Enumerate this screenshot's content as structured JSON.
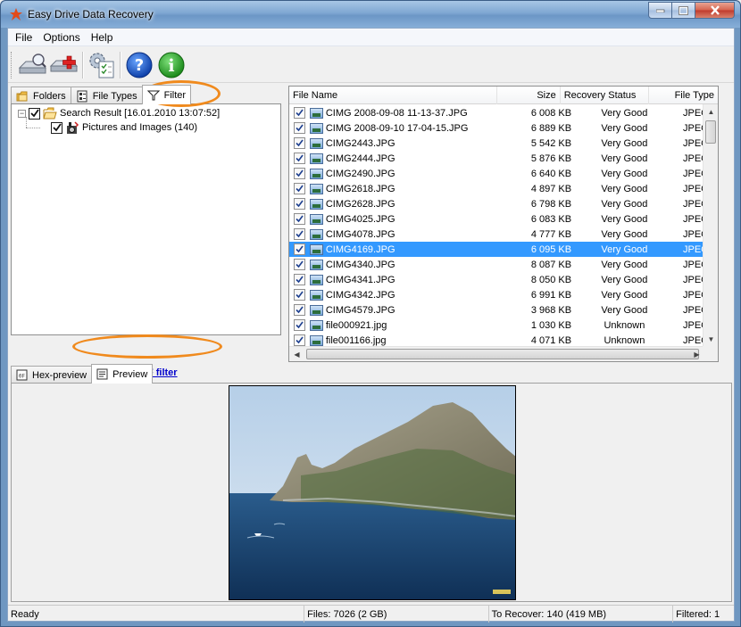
{
  "window": {
    "title": "Easy Drive Data Recovery",
    "buttons": {
      "minimize": "–",
      "maximize": "□",
      "close": "✕"
    }
  },
  "menu": [
    "File",
    "Options",
    "Help"
  ],
  "toolbar": {
    "icons": [
      "scan-drive-icon",
      "drive-recover-icon",
      "settings-icon",
      "help-icon",
      "info-icon"
    ]
  },
  "left_tabs": [
    {
      "label": "Folders",
      "icon": "folders-icon"
    },
    {
      "label": "File Types",
      "icon": "file-types-icon"
    },
    {
      "label": "Filter",
      "icon": "filter-icon",
      "active": true
    }
  ],
  "tree": {
    "root": {
      "label": "Search Result [16.01.2010 13:07:52]",
      "checked": true,
      "expanded": true
    },
    "child": {
      "label": "Pictures and Images (140)",
      "checked": true
    }
  },
  "filter_link": "Turn OFF filter",
  "file_list": {
    "columns": [
      "File Name",
      "Size",
      "Recovery Status",
      "File Type"
    ],
    "rows": [
      {
        "name": "CIMG 2008-09-08 11-13-37.JPG",
        "size": "6 008 KB",
        "status": "Very Good",
        "type": "JPEG"
      },
      {
        "name": "CIMG 2008-09-10 17-04-15.JPG",
        "size": "6 889 KB",
        "status": "Very Good",
        "type": "JPEG"
      },
      {
        "name": "CIMG2443.JPG",
        "size": "5 542 KB",
        "status": "Very Good",
        "type": "JPEG"
      },
      {
        "name": "CIMG2444.JPG",
        "size": "5 876 KB",
        "status": "Very Good",
        "type": "JPEG"
      },
      {
        "name": "CIMG2490.JPG",
        "size": "6 640 KB",
        "status": "Very Good",
        "type": "JPEG"
      },
      {
        "name": "CIMG2618.JPG",
        "size": "4 897 KB",
        "status": "Very Good",
        "type": "JPEG"
      },
      {
        "name": "CIMG2628.JPG",
        "size": "6 798 KB",
        "status": "Very Good",
        "type": "JPEG"
      },
      {
        "name": "CIMG4025.JPG",
        "size": "6 083 KB",
        "status": "Very Good",
        "type": "JPEG"
      },
      {
        "name": "CIMG4078.JPG",
        "size": "4 777 KB",
        "status": "Very Good",
        "type": "JPEG"
      },
      {
        "name": "CIMG4169.JPG",
        "size": "6 095 KB",
        "status": "Very Good",
        "type": "JPEG",
        "selected": true
      },
      {
        "name": "CIMG4340.JPG",
        "size": "8 087 KB",
        "status": "Very Good",
        "type": "JPEG"
      },
      {
        "name": "CIMG4341.JPG",
        "size": "8 050 KB",
        "status": "Very Good",
        "type": "JPEG"
      },
      {
        "name": "CIMG4342.JPG",
        "size": "6 991 KB",
        "status": "Very Good",
        "type": "JPEG"
      },
      {
        "name": "CIMG4579.JPG",
        "size": "3 968 KB",
        "status": "Very Good",
        "type": "JPEG"
      },
      {
        "name": "file000921.jpg",
        "size": "1 030 KB",
        "status": "Unknown",
        "type": "JPEG"
      },
      {
        "name": "file001166.jpg",
        "size": "4 071 KB",
        "status": "Unknown",
        "type": "JPEG"
      }
    ]
  },
  "bottom_tabs": [
    {
      "label": "Hex-preview",
      "icon": "hex-icon"
    },
    {
      "label": "Preview",
      "icon": "preview-icon",
      "active": true
    }
  ],
  "status_bar": {
    "state": "Ready",
    "files": "Files: 7026 (2 GB)",
    "to_recover": "To Recover: 140 (419 MB)",
    "filtered": "Filtered: 1"
  },
  "colors": {
    "selection": "#3399ff",
    "highlight_oval": "#f08a1d",
    "link": "#0000cc"
  }
}
